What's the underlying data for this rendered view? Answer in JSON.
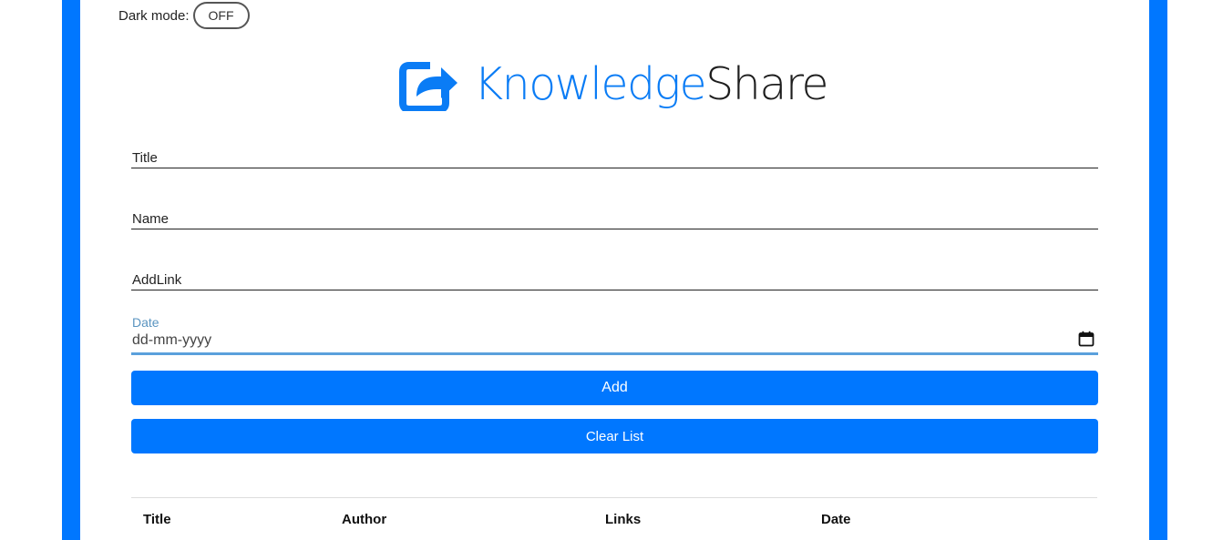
{
  "dark_mode": {
    "label": "Dark mode:",
    "toggle_state": "OFF"
  },
  "brand": {
    "part1": "Knowledge",
    "part2": "Share",
    "accent_color": "#0077ff"
  },
  "form": {
    "title_placeholder": "Title",
    "name_placeholder": "Name",
    "link_placeholder": "AddLink",
    "date_label": "Date",
    "date_placeholder": "dd-mm-yyyy"
  },
  "buttons": {
    "add": "Add",
    "clear": "Clear List"
  },
  "table": {
    "headers": [
      "Title",
      "Author",
      "Links",
      "Date"
    ]
  }
}
